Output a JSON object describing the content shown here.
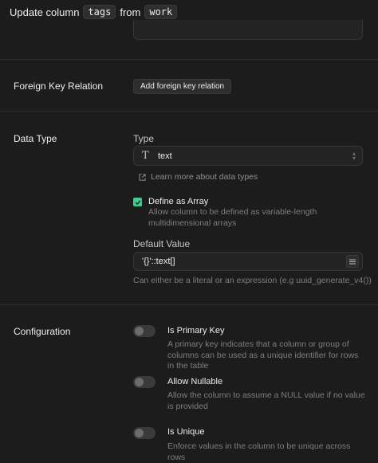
{
  "header": {
    "prefix": "Update column",
    "column": "tags",
    "middle": "from",
    "table": "work"
  },
  "foreign_key": {
    "label": "Foreign Key Relation",
    "button": "Add foreign key relation"
  },
  "data_type": {
    "section_label": "Data Type",
    "type_label": "Type",
    "type_value": "text",
    "learn_more": "Learn more about data types",
    "array_title": "Define as Array",
    "array_desc": "Allow column to be defined as variable-length multidimensional arrays",
    "array_checked": true,
    "default_label": "Default Value",
    "default_value": "'{}'::text[]",
    "default_hint": "Can either be a literal or an expression (e.g uuid_generate_v4())"
  },
  "configuration": {
    "section_label": "Configuration",
    "primary_key": {
      "title": "Is Primary Key",
      "desc": "A primary key indicates that a column or group of columns can be used as a unique identifier for rows in the table",
      "on": false
    },
    "nullable": {
      "title": "Allow Nullable",
      "desc": "Allow the column to assume a NULL value if no value is provided",
      "on": false
    },
    "unique": {
      "title": "Is Unique",
      "desc": "Enforce values in the column to be unique across rows",
      "on": false
    }
  },
  "colors": {
    "background": "#1c1c1c",
    "accent_green": "#3ecf8e",
    "muted_text": "#7e7e7e"
  },
  "icons": [
    "text-type-icon",
    "chevron-updown-icon",
    "external-link-icon",
    "check-icon",
    "list-menu-icon"
  ]
}
